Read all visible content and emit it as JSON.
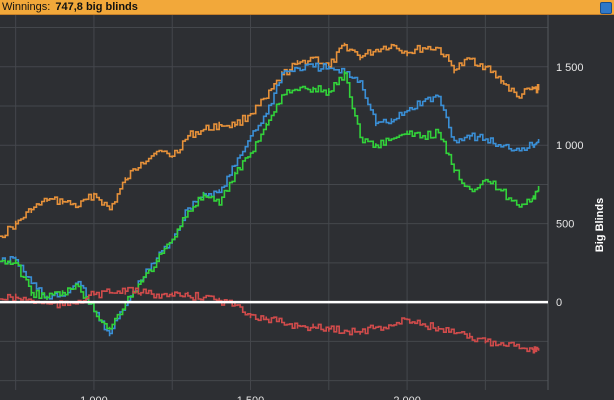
{
  "header": {
    "label": "Winnings:",
    "value": "747,8 big blinds",
    "icon": "info-icon"
  },
  "chart_data": {
    "type": "line",
    "title": "",
    "xlabel": "",
    "ylabel": "Big Blinds",
    "xlim": [
      700,
      2450
    ],
    "ylim": [
      -560,
      1830
    ],
    "grid": true,
    "x_ticks": [
      {
        "value": 1000,
        "label": "1.000"
      },
      {
        "value": 1500,
        "label": "1.500"
      },
      {
        "value": 2000,
        "label": "2.000"
      }
    ],
    "y_ticks": [
      {
        "value": 0,
        "label": "0"
      },
      {
        "value": 500,
        "label": "500"
      },
      {
        "value": 1000,
        "label": "1 000"
      },
      {
        "value": 1500,
        "label": "1 500"
      }
    ],
    "zero_line": 0,
    "series": [
      {
        "color": "#e6913a",
        "x": [
          700,
          750,
          800,
          850,
          900,
          950,
          1000,
          1050,
          1100,
          1150,
          1200,
          1250,
          1300,
          1350,
          1400,
          1450,
          1500,
          1550,
          1600,
          1650,
          1700,
          1750,
          1800,
          1850,
          1900,
          1950,
          2000,
          2050,
          2100,
          2150,
          2200,
          2250,
          2300,
          2350,
          2400,
          2420
        ],
        "y": [
          420,
          500,
          590,
          650,
          640,
          610,
          690,
          590,
          780,
          890,
          960,
          930,
          1060,
          1100,
          1130,
          1130,
          1200,
          1300,
          1450,
          1520,
          1560,
          1500,
          1640,
          1560,
          1610,
          1640,
          1590,
          1620,
          1620,
          1480,
          1550,
          1500,
          1410,
          1310,
          1360,
          1360
        ]
      },
      {
        "color": "#3a8fd6",
        "x": [
          700,
          750,
          800,
          850,
          900,
          950,
          1000,
          1050,
          1100,
          1150,
          1200,
          1250,
          1300,
          1350,
          1400,
          1450,
          1500,
          1550,
          1600,
          1650,
          1700,
          1750,
          1800,
          1850,
          1900,
          1950,
          2000,
          2050,
          2100,
          2150,
          2200,
          2250,
          2300,
          2350,
          2400,
          2420
        ],
        "y": [
          260,
          270,
          120,
          30,
          40,
          130,
          -60,
          -200,
          -20,
          140,
          280,
          400,
          600,
          690,
          700,
          870,
          1060,
          1200,
          1460,
          1490,
          1500,
          1490,
          1460,
          1410,
          1140,
          1150,
          1220,
          1280,
          1310,
          1030,
          1060,
          1040,
          990,
          980,
          1000,
          1040
        ]
      },
      {
        "color": "#32d23a",
        "x": [
          700,
          750,
          800,
          850,
          900,
          950,
          1000,
          1050,
          1100,
          1150,
          1200,
          1250,
          1300,
          1350,
          1400,
          1450,
          1500,
          1550,
          1600,
          1650,
          1700,
          1750,
          1800,
          1850,
          1900,
          1950,
          2000,
          2050,
          2100,
          2150,
          2200,
          2250,
          2300,
          2350,
          2400,
          2420
        ],
        "y": [
          260,
          250,
          60,
          30,
          60,
          100,
          -60,
          -170,
          0,
          130,
          260,
          400,
          580,
          680,
          620,
          820,
          950,
          1130,
          1320,
          1350,
          1360,
          1340,
          1460,
          1050,
          1000,
          1040,
          1070,
          1060,
          1080,
          840,
          720,
          780,
          710,
          620,
          660,
          720
        ]
      },
      {
        "color": "#d04b4b",
        "x": [
          700,
          750,
          800,
          850,
          900,
          950,
          1000,
          1050,
          1100,
          1150,
          1200,
          1250,
          1300,
          1350,
          1400,
          1450,
          1500,
          1550,
          1600,
          1650,
          1700,
          1750,
          1800,
          1850,
          1900,
          1950,
          2000,
          2050,
          2100,
          2150,
          2200,
          2250,
          2300,
          2350,
          2400,
          2420
        ],
        "y": [
          20,
          30,
          10,
          -10,
          -20,
          10,
          50,
          60,
          70,
          60,
          50,
          40,
          40,
          30,
          10,
          -20,
          -80,
          -110,
          -130,
          -150,
          -160,
          -170,
          -180,
          -190,
          -160,
          -150,
          -110,
          -140,
          -170,
          -200,
          -220,
          -250,
          -260,
          -270,
          -300,
          -310
        ]
      }
    ]
  }
}
